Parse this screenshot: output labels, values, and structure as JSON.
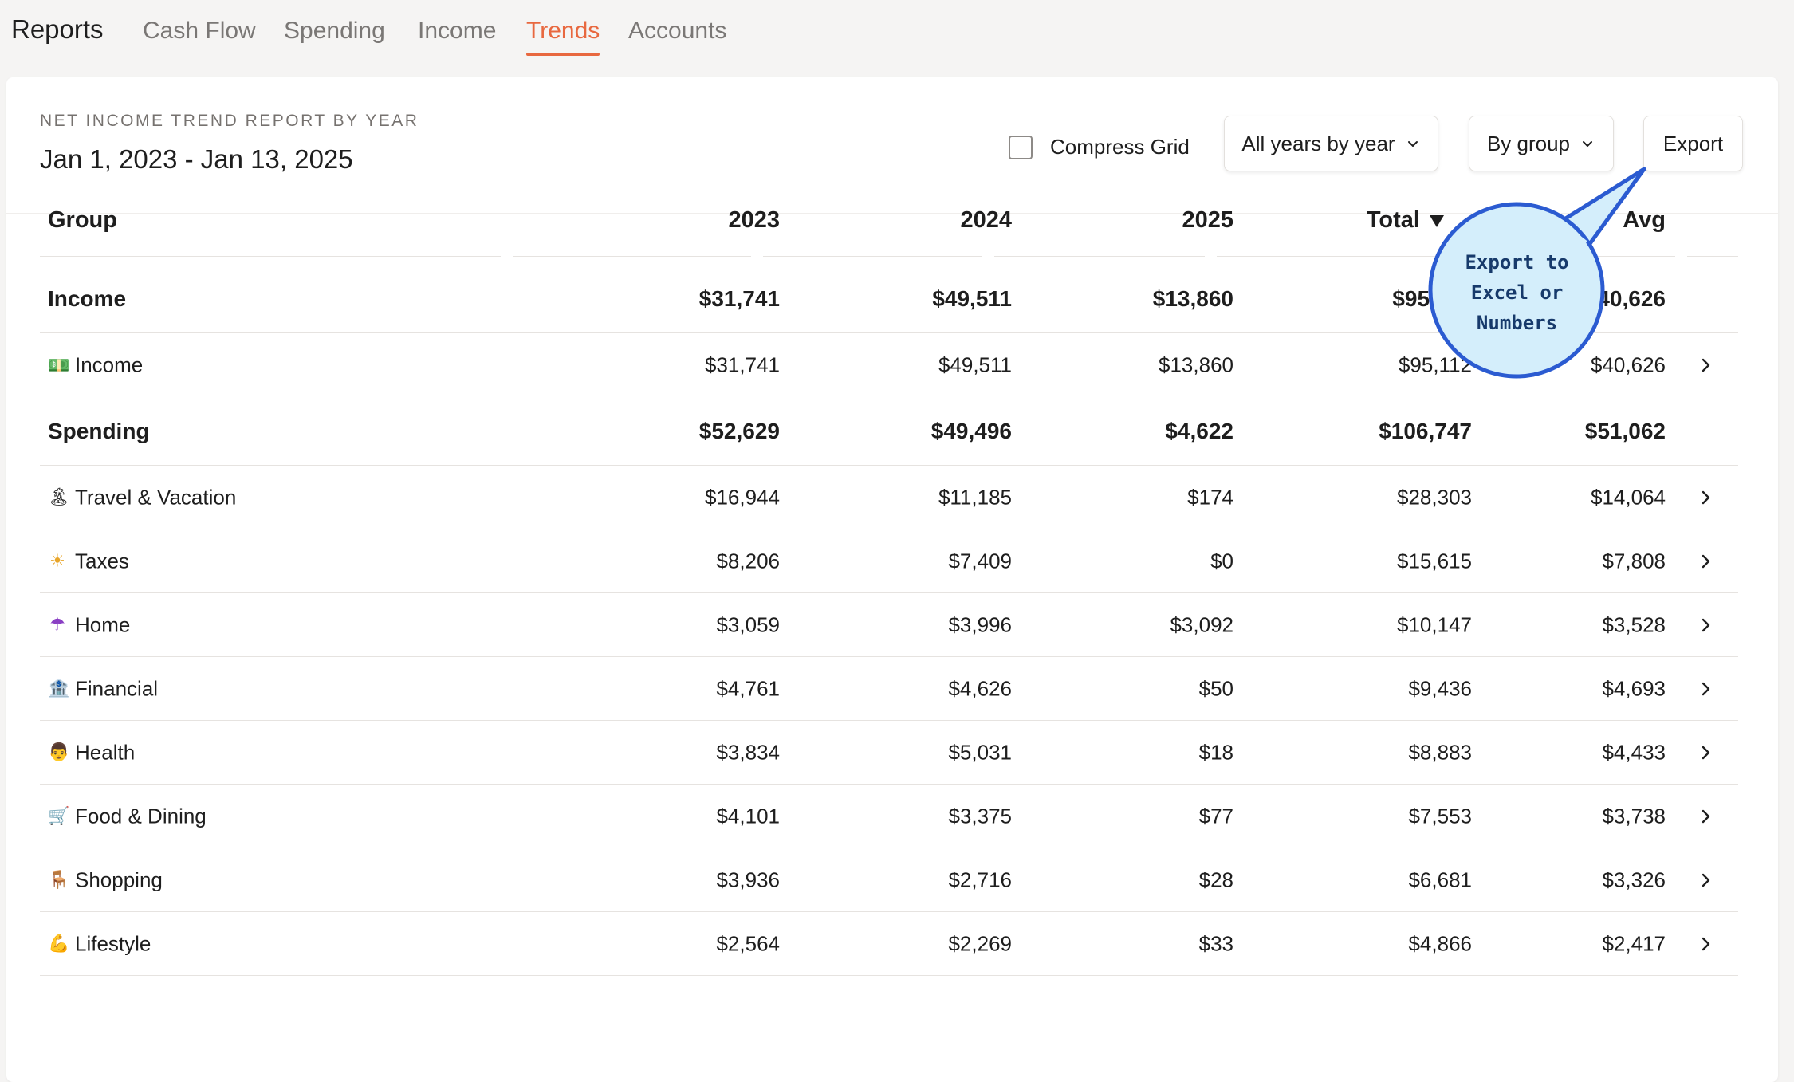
{
  "nav": {
    "brand": "Reports",
    "tabs": [
      "Cash Flow",
      "Spending",
      "Income",
      "Trends",
      "Accounts"
    ],
    "active_tab": "Trends"
  },
  "report": {
    "kicker": "NET INCOME TREND REPORT BY YEAR",
    "range": "Jan 1, 2023 - Jan 13, 2025"
  },
  "controls": {
    "compress_label": "Compress Grid",
    "compress_checked": false,
    "period_select": "All years by year",
    "group_select": "By group",
    "export_label": "Export"
  },
  "callout": {
    "line1": "Export to",
    "line2": "Excel or",
    "line3": "Numbers"
  },
  "table": {
    "headers": {
      "group": "Group",
      "y2023": "2023",
      "y2024": "2024",
      "y2025": "2025",
      "total": "Total",
      "avg": "Avg"
    },
    "income_group": {
      "name": "Income",
      "y2023": "$31,741",
      "y2024": "$49,511",
      "y2025": "$13,860",
      "total": "$95,112",
      "avg": "$40,626"
    },
    "income_rows": [
      {
        "icon": "money-icon",
        "emoji": "💵",
        "name": "Income",
        "y2023": "$31,741",
        "y2024": "$49,511",
        "y2025": "$13,860",
        "total": "$95,112",
        "avg": "$40,626"
      }
    ],
    "spending_group": {
      "name": "Spending",
      "y2023": "$52,629",
      "y2024": "$49,496",
      "y2025": "$4,622",
      "total": "$106,747",
      "avg": "$51,062"
    },
    "spending_rows": [
      {
        "icon": "island-icon",
        "emoji": "🏝",
        "name": "Travel & Vacation",
        "y2023": "$16,944",
        "y2024": "$11,185",
        "y2025": "$174",
        "total": "$28,303",
        "avg": "$14,064"
      },
      {
        "icon": "sun-icon",
        "emoji": "☀",
        "name": "Taxes",
        "y2023": "$8,206",
        "y2024": "$7,409",
        "y2025": "$0",
        "total": "$15,615",
        "avg": "$7,808"
      },
      {
        "icon": "umbrella-icon",
        "emoji": "☂",
        "name": "Home",
        "y2023": "$3,059",
        "y2024": "$3,996",
        "y2025": "$3,092",
        "total": "$10,147",
        "avg": "$3,528"
      },
      {
        "icon": "bank-icon",
        "emoji": "🏦",
        "name": "Financial",
        "y2023": "$4,761",
        "y2024": "$4,626",
        "y2025": "$50",
        "total": "$9,436",
        "avg": "$4,693"
      },
      {
        "icon": "health-worker-icon",
        "emoji": "👨",
        "name": "Health",
        "y2023": "$3,834",
        "y2024": "$5,031",
        "y2025": "$18",
        "total": "$8,883",
        "avg": "$4,433"
      },
      {
        "icon": "shopping-cart-icon",
        "emoji": "🛒",
        "name": "Food & Dining",
        "y2023": "$4,101",
        "y2024": "$3,375",
        "y2025": "$77",
        "total": "$7,553",
        "avg": "$3,738"
      },
      {
        "icon": "chair-icon",
        "emoji": "🪑",
        "name": "Shopping",
        "y2023": "$3,936",
        "y2024": "$2,716",
        "y2025": "$28",
        "total": "$6,681",
        "avg": "$3,326"
      },
      {
        "icon": "flexed-biceps-icon",
        "emoji": "💪",
        "name": "Lifestyle",
        "y2023": "$2,564",
        "y2024": "$2,269",
        "y2025": "$33",
        "total": "$4,866",
        "avg": "$2,417"
      }
    ]
  },
  "colors": {
    "accent": "#e8683f",
    "callout_fill": "#d4eefb",
    "callout_stroke": "#2b5bd1"
  }
}
